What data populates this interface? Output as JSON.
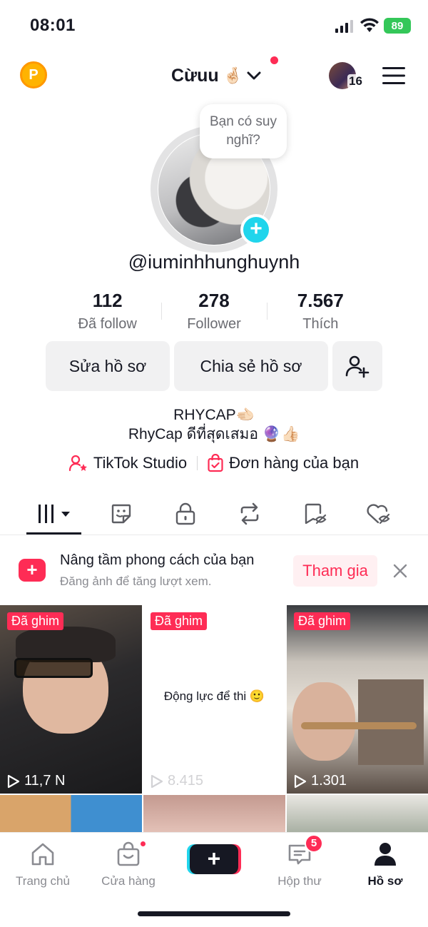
{
  "status_bar": {
    "time": "08:01",
    "battery": "89"
  },
  "header": {
    "account_name": "Cừuu",
    "hand_emoji": "🤞🏻",
    "friends_count": "16",
    "coin_letter": "P"
  },
  "profile": {
    "thought_bubble": "Bạn có suy nghĩ?",
    "username": "@iuminhhunghuynh",
    "stats": [
      {
        "value": "112",
        "label": "Đã follow"
      },
      {
        "value": "278",
        "label": "Follower"
      },
      {
        "value": "7.567",
        "label": "Thích"
      }
    ],
    "edit_button": "Sửa hồ sơ",
    "share_button": "Chia sẻ hồ sơ",
    "bio_line1": "RHYCAP🫲🏻",
    "bio_line2": "RhyCap ดีที่สุดเสมอ 🔮👍🏻",
    "studio_link": "TikTok Studio",
    "orders_link": "Đơn hàng của bạn"
  },
  "banner": {
    "title": "Nâng tầm phong cách của bạn",
    "subtitle": "Đăng ảnh để tăng lượt xem.",
    "join_label": "Tham gia"
  },
  "videos": [
    {
      "pinned": "Đã ghim",
      "views": "11,7 N"
    },
    {
      "pinned": "Đã ghim",
      "views": "8.415",
      "caption": "Động lực để thi 🙂"
    },
    {
      "pinned": "Đã ghim",
      "views": "1.301"
    }
  ],
  "bottom_nav": [
    {
      "label": "Trang chủ"
    },
    {
      "label": "Cửa hàng"
    },
    {
      "label": "Hộp thư",
      "badge": "5"
    },
    {
      "label": "Hồ sơ"
    }
  ],
  "colors": {
    "accent": "#fe2c55",
    "cyan": "#20d5ec",
    "text": "#161823",
    "muted": "#8a8b91"
  }
}
